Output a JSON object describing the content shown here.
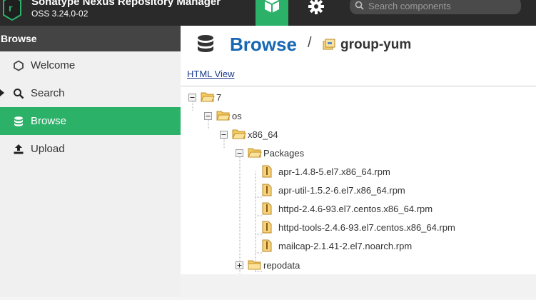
{
  "app": {
    "title": "Sonatype Nexus Repository Manager",
    "version": "OSS 3.24.0-02"
  },
  "search": {
    "placeholder": "Search components"
  },
  "sidebar": {
    "header": "Browse",
    "items": [
      {
        "label": "Welcome",
        "icon": "hexagon-icon"
      },
      {
        "label": "Search",
        "icon": "search-icon"
      },
      {
        "label": "Browse",
        "icon": "database-icon",
        "active": true
      },
      {
        "label": "Upload",
        "icon": "upload-icon"
      }
    ]
  },
  "main": {
    "title": "Browse",
    "separator": "/",
    "repo": "group-yum",
    "html_view": "HTML View"
  },
  "tree": {
    "root": "7",
    "os": "os",
    "arch": "x86_64",
    "packages": "Packages",
    "files": [
      "apr-1.4.8-5.el7.x86_64.rpm",
      "apr-util-1.5.2-6.el7.x86_64.rpm",
      "httpd-2.4.6-93.el7.centos.x86_64.rpm",
      "httpd-tools-2.4.6-93.el7.centos.x86_64.rpm",
      "mailcap-2.1.41-2.el7.noarch.rpm"
    ],
    "repodata": "repodata"
  },
  "colors": {
    "accent": "#2cb169",
    "link": "#1767b3",
    "topbar": "#2a2a2a"
  }
}
